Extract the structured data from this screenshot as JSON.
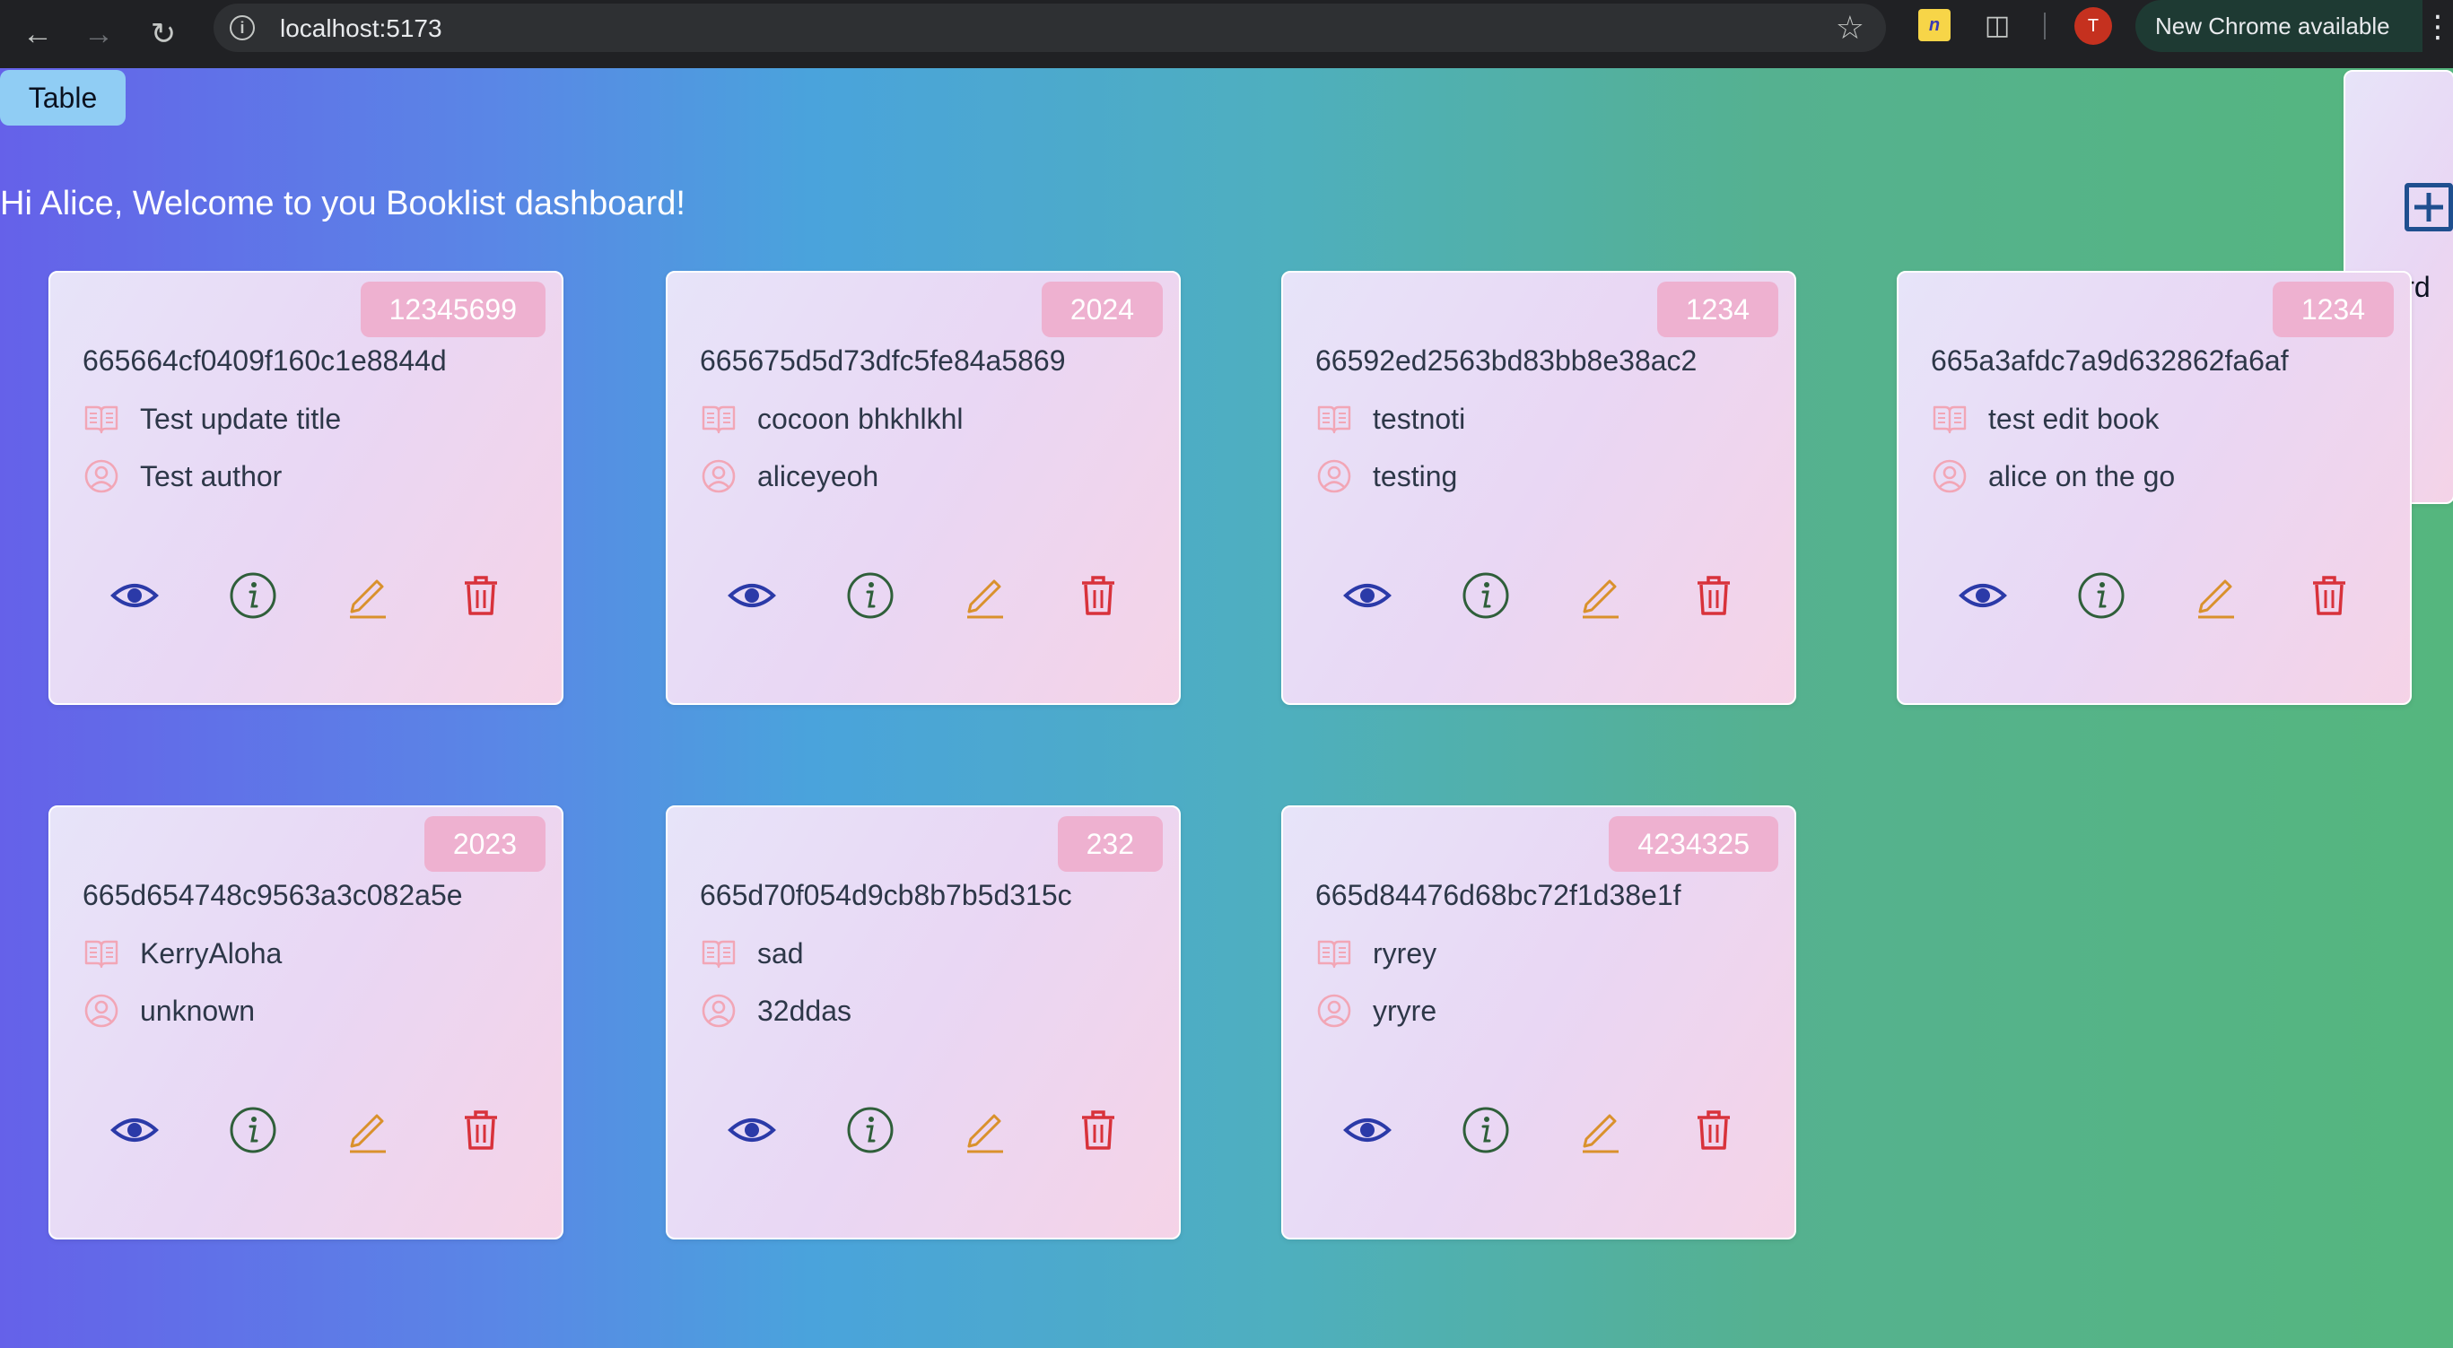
{
  "browser": {
    "url": "localhost:5173",
    "profile_initial": "T",
    "update_label": "New Chrome available",
    "extension_label": "n"
  },
  "toolbar": {
    "table_label": "Table",
    "card_label": "Card"
  },
  "welcome_text": "Hi Alice, Welcome to you Booklist dashboard!",
  "icons": {
    "title_icon": "book-open-icon",
    "author_icon": "user-circle-icon",
    "actions": [
      "eye-icon",
      "info-icon",
      "pencil-icon",
      "trash-icon"
    ]
  },
  "colors": {
    "badge": "#eeb1d0",
    "view": "#2b3aa8",
    "info": "#2f5f3a",
    "edit": "#d9912c",
    "delete": "#d8323b",
    "meta_icon": "#f2a6b6"
  },
  "books": [
    {
      "year": "12345699",
      "id": "665664cf0409f160c1e8844d",
      "title": "Test update title",
      "author": "Test author"
    },
    {
      "year": "2024",
      "id": "665675d5d73dfc5fe84a5869",
      "title": "cocoon bhkhlkhl",
      "author": "aliceyeoh"
    },
    {
      "year": "1234",
      "id": "66592ed2563bd83bb8e38ac2",
      "title": "testnoti",
      "author": "testing"
    },
    {
      "year": "1234",
      "id": "665a3afdc7a9d632862fa6af",
      "title": "test edit book",
      "author": "alice on the go"
    },
    {
      "year": "2023",
      "id": "665d654748c9563a3c082a5e",
      "title": "KerryAloha",
      "author": "unknown"
    },
    {
      "year": "232",
      "id": "665d70f054d9cb8b7b5d315c",
      "title": "sad",
      "author": "32ddas"
    },
    {
      "year": "4234325",
      "id": "665d84476d68bc72f1d38e1f",
      "title": "ryrey",
      "author": "yryre"
    }
  ]
}
